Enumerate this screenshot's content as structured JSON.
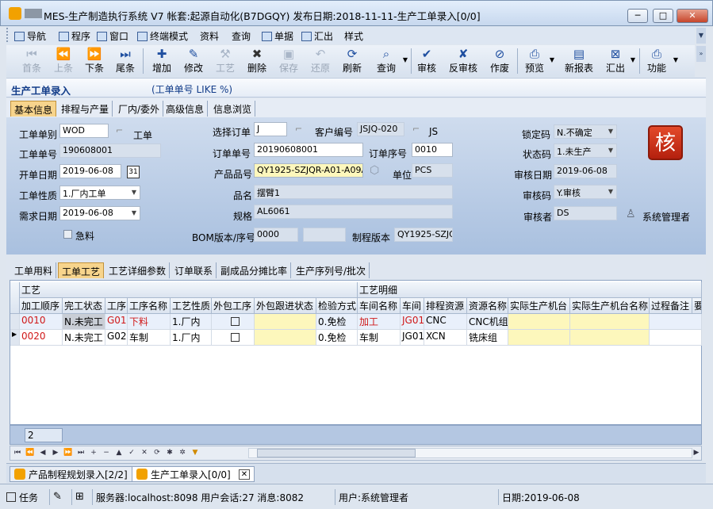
{
  "window": {
    "title": "MES-生产制造执行系统 V7 帐套:起源自动化(B7DGQY) 发布日期:2018-11-11-生产工单录入[0/0]",
    "min": "─",
    "max": "□",
    "close": "✕"
  },
  "menu": [
    "导航",
    "程序",
    "窗口",
    "终端模式",
    "资料",
    "查询",
    "单据",
    "汇出",
    "样式"
  ],
  "toolbar": {
    "first": "首条",
    "prev": "上条",
    "next": "下条",
    "last": "尾条",
    "add": "增加",
    "edit": "修改",
    "craft": "工艺",
    "delete": "删除",
    "save": "保存",
    "restore": "还原",
    "refresh": "刷新",
    "query": "查询",
    "audit": "审核",
    "unaudit": "反审核",
    "void": "作废",
    "preview": "预览",
    "newreport": "新报表",
    "export": "汇出",
    "function": "功能"
  },
  "strip": {
    "title": "生产工单录入",
    "filter": "(工单单号 LIKE %)"
  },
  "top_tabs": [
    "基本信息",
    "排程与产量",
    "厂内/委外",
    "高级信息",
    "信息浏览"
  ],
  "form": {
    "order_type_label": "工单单别",
    "order_type_value": "WOD",
    "order_type_name": "工单",
    "order_no_label": "工单单号",
    "order_no_value": "190608001",
    "open_date_label": "开单日期",
    "open_date_value": "2019-06-08",
    "nature_label": "工单性质",
    "nature_value": "1.厂内工单",
    "demand_date_label": "需求日期",
    "demand_date_value": "2019-06-08",
    "urgent_label": "急料",
    "sel_order_label": "选择订单",
    "sel_order_value": "J",
    "cust_no_label": "客户编号",
    "cust_no_value": "JSJQ-020",
    "cust_name": "JS",
    "sales_order_label": "订单单号",
    "sales_order_value": "20190608001",
    "order_seq_label": "订单序号",
    "order_seq_value": "0010",
    "product_no_label": "产品品号",
    "product_no_value": "QY1925-SZJQR-A01-A09A",
    "unit_label": "单位",
    "unit_value": "PCS",
    "name_label": "品名",
    "name_value": "摆臂1",
    "spec_label": "规格",
    "spec_value": "AL6061",
    "bom_label": "BOM版本/序号",
    "bom_value": "0000",
    "bom_seq": "",
    "proc_ver_label": "制程版本",
    "proc_ver_value": "QY1925-SZJQR",
    "lock_label": "锁定码",
    "lock_value": "N.不确定",
    "status_label": "状态码",
    "status_value": "1.未生产",
    "audit_date_label": "审核日期",
    "audit_date_value": "2019-06-08",
    "audit_code_label": "审核码",
    "audit_code_value": "Y.审核",
    "auditor_label": "审核者",
    "auditor_value": "DS",
    "auditor_name": "系统管理者",
    "he_button": "核",
    "cal_icon": "31"
  },
  "sub_tabs": [
    "工单用料",
    "工单工艺",
    "工艺详细参数",
    "订单联系",
    "副成品分摊比率",
    "生产序列号/批次"
  ],
  "grid": {
    "group1": "工艺",
    "group2": "工艺明细",
    "columns": [
      "加工顺序",
      "完工状态",
      "工序",
      "工序名称",
      "工艺性质",
      "外包工序",
      "外包跟进状态",
      "检验方式",
      "车间名称",
      "车间",
      "排程资源",
      "资源名称",
      "实际生产机台",
      "实际生产机台名称",
      "过程备注",
      "要"
    ],
    "rows": [
      {
        "seq": "0010",
        "status": "N.未完工",
        "proc": "G01",
        "proc_name": "下料",
        "nature": "1.厂内",
        "outs_status": "",
        "inspect": "0.免检",
        "ws_name": "加工",
        "ws": "JG01",
        "res": "CNC",
        "res_name": "CNC机组",
        "mach": "",
        "mach_name": "",
        "remark": ""
      },
      {
        "seq": "0020",
        "status": "N.未完工",
        "proc": "G02",
        "proc_name": "车制",
        "nature": "1.厂内",
        "outs_status": "",
        "inspect": "0.免检",
        "ws_name": "车制",
        "ws": "JG01",
        "res": "XCN",
        "res_name": "铣床组",
        "mach": "",
        "mach_name": "",
        "remark": ""
      }
    ],
    "count": "2",
    "row_pointer": "▶"
  },
  "bottom_tabs": [
    "产品制程规划录入[2/2]",
    "生产工单录入[0/0]"
  ],
  "status": {
    "task": "任务",
    "server": "服务器:localhost:8098 用户会话:27 消息:8082",
    "user": "用户:系统管理者",
    "date": "日期:2019-06-08"
  }
}
